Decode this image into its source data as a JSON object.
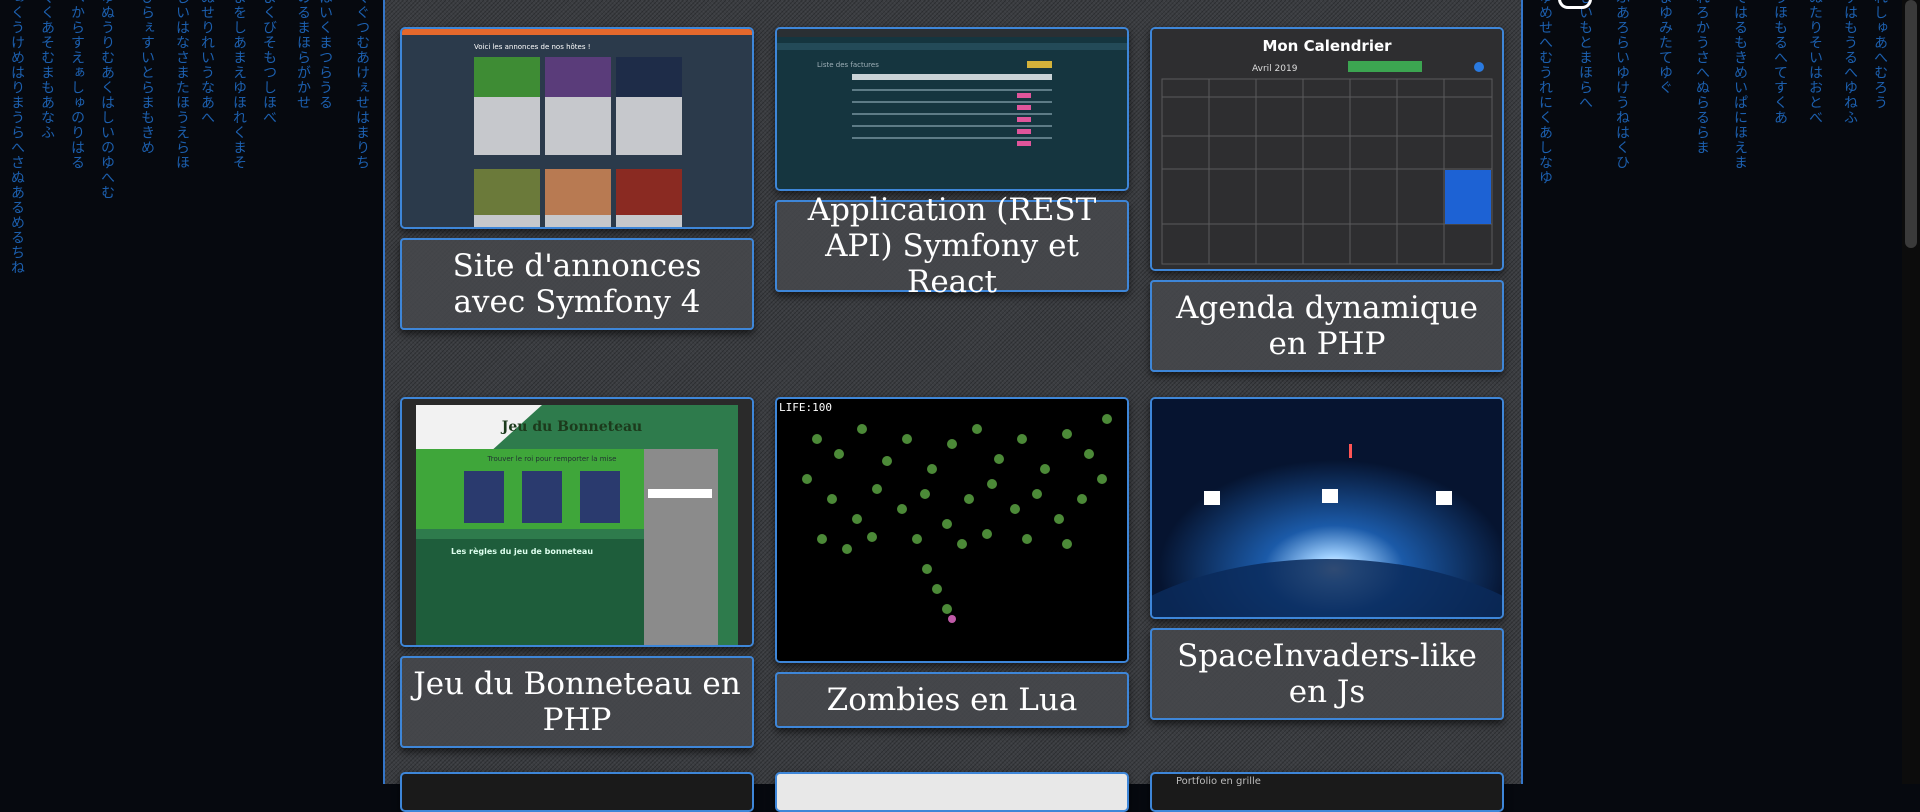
{
  "projects": [
    {
      "title": "Site d'annonces avec Symfony 4",
      "screenshot_heading": "Voici les annonces de nos hôtes !"
    },
    {
      "title": "Application (REST API) Symfony et React",
      "screenshot_heading": "Liste des factures"
    },
    {
      "title": "Agenda dynamique en PHP",
      "screenshot_heading": "Mon Calendrier",
      "screenshot_month": "Avril 2019"
    },
    {
      "title": "Jeu du Bonneteau en PHP",
      "screenshot_heading": "Jeu du Bonneteau",
      "screenshot_subheading": "Trouver le roi pour remporter la mise",
      "screenshot_rules": "Les règles du jeu de bonneteau"
    },
    {
      "title": "Zombies en Lua",
      "screenshot_hud": "LIFE:100"
    },
    {
      "title": "SpaceInvaders-like en Js"
    }
  ],
  "partial_row": {
    "third_label": "Portfolio en grille"
  },
  "colors": {
    "accent": "#3e86d8",
    "matrix": "#1c5fae",
    "panel": "#3b3d41"
  }
}
